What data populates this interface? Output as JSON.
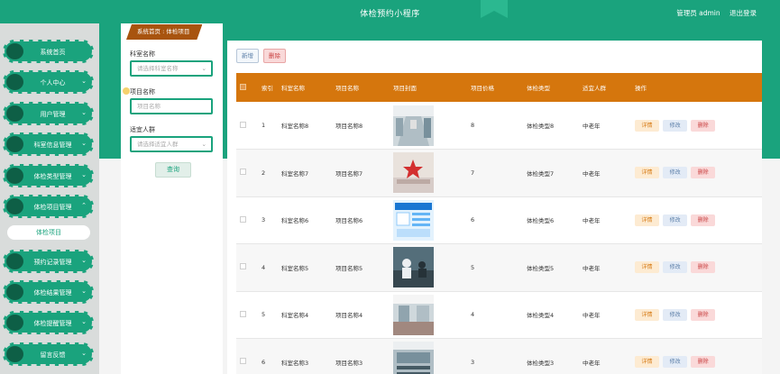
{
  "header": {
    "title": "体检预约小程序",
    "admin_label": "管理员 admin",
    "logout": "退出登录"
  },
  "sidebar": {
    "items": [
      {
        "label": "系统首页",
        "expanded": false
      },
      {
        "label": "个人中心",
        "expanded": false
      },
      {
        "label": "用户管理",
        "expanded": false
      },
      {
        "label": "科室信息管理",
        "expanded": false
      },
      {
        "label": "体检类型管理",
        "expanded": false
      },
      {
        "label": "体检项目管理",
        "expanded": true
      },
      {
        "label": "预约记录管理",
        "expanded": false
      },
      {
        "label": "体检结果管理",
        "expanded": false
      },
      {
        "label": "体检提醒管理",
        "expanded": false
      },
      {
        "label": "留言反馈",
        "expanded": false
      }
    ],
    "sub_item": "体检项目"
  },
  "breadcrumb": {
    "home": "系统首页",
    "sep": ":",
    "current": "体检项目"
  },
  "filters": {
    "dept_label": "科室名称",
    "dept_placeholder": "请选择科室名称",
    "item_label": "项目名称",
    "item_placeholder": "项目名称",
    "crowd_label": "适宜人群",
    "crowd_placeholder": "请选择适宜人群",
    "search_button": "查询"
  },
  "toolbar": {
    "add_button": "新增",
    "delete_button": "删除"
  },
  "table": {
    "headers": [
      "索引",
      "科室名称",
      "项目名称",
      "项目封面",
      "项目价格",
      "体检类型",
      "适宜人群",
      "操作"
    ],
    "rows": [
      {
        "index": "1",
        "dept": "科室名称8",
        "name": "项目名称8",
        "price": "8",
        "type": "体检类型8",
        "crowd": "中老年"
      },
      {
        "index": "2",
        "dept": "科室名称7",
        "name": "项目名称7",
        "price": "7",
        "type": "体检类型7",
        "crowd": "中老年"
      },
      {
        "index": "3",
        "dept": "科室名称6",
        "name": "项目名称6",
        "price": "6",
        "type": "体检类型6",
        "crowd": "中老年"
      },
      {
        "index": "4",
        "dept": "科室名称5",
        "name": "项目名称5",
        "price": "5",
        "type": "体检类型5",
        "crowd": "中老年"
      },
      {
        "index": "5",
        "dept": "科室名称4",
        "name": "项目名称4",
        "price": "4",
        "type": "体检类型4",
        "crowd": "中老年"
      },
      {
        "index": "6",
        "dept": "科室名称3",
        "name": "项目名称3",
        "price": "3",
        "type": "体检类型3",
        "crowd": "中老年"
      }
    ],
    "actions": {
      "detail": "详情",
      "edit": "修改",
      "delete": "删除"
    }
  },
  "colors": {
    "primary": "#1aa37d",
    "header": "#d5760d",
    "breadcrumb": "#a8540f"
  }
}
